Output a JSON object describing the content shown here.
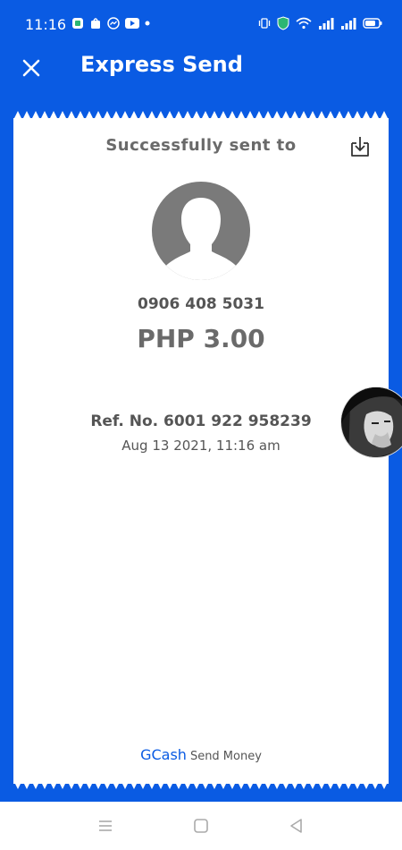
{
  "status_bar": {
    "time": "11:16",
    "icons_left": [
      "message-app-icon",
      "shop-icon",
      "messenger-icon",
      "youtube-icon",
      "dot-icon"
    ],
    "icons_right": [
      "vibrate-icon",
      "shield-icon",
      "wifi-icon",
      "signal-icon",
      "signal-icon",
      "battery-icon"
    ]
  },
  "header": {
    "title": "Express Send",
    "close_icon": "close-icon"
  },
  "receipt": {
    "heading": "Successfully sent to",
    "download_icon": "download-icon",
    "recipient_number": "0906 408 5031",
    "amount": "PHP 3.00",
    "reference": "Ref. No. 6001 922 958239",
    "datetime": "Aug 13 2021, 11:16 am",
    "brand": "GCash",
    "brand_sub": "Send Money"
  },
  "colors": {
    "accent": "#0a5be3",
    "text_gray": "#6a6a6a"
  },
  "nav": {
    "icons": [
      "menu-icon",
      "home-icon",
      "back-icon"
    ]
  }
}
